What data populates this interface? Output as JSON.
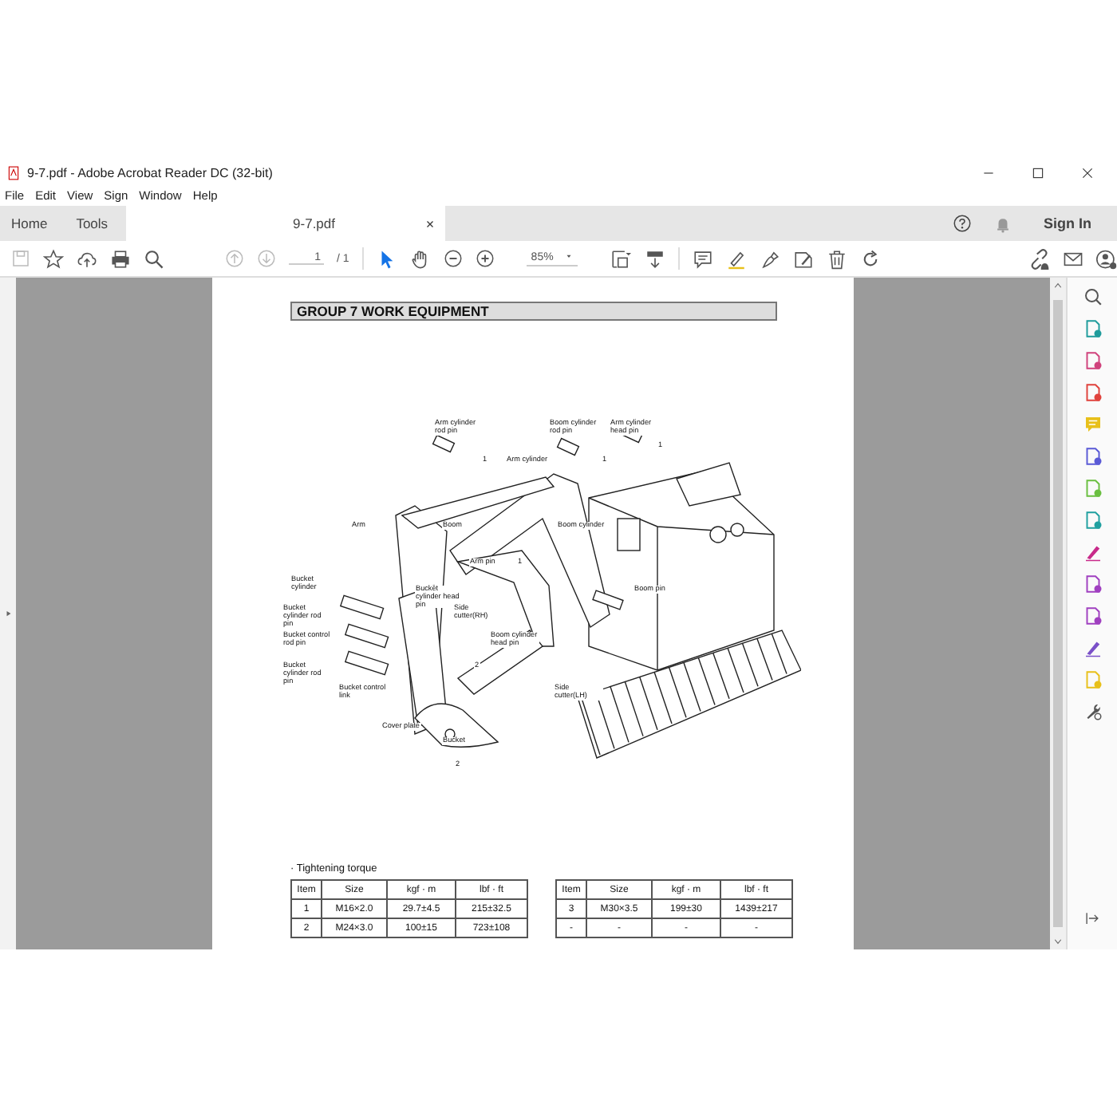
{
  "window": {
    "title": "9-7.pdf - Adobe Acrobat Reader DC (32-bit)"
  },
  "menu": [
    "File",
    "Edit",
    "View",
    "Sign",
    "Window",
    "Help"
  ],
  "tabs": [
    {
      "label": "Home",
      "selected": false
    },
    {
      "label": "Tools",
      "selected": false
    },
    {
      "label": "9-7.pdf",
      "selected": true
    }
  ],
  "sign_in": "Sign In",
  "toolbar": {
    "page": "1",
    "page_total": "/ 1",
    "zoom": "85%",
    "select_tool_selected": true
  },
  "document": {
    "heading": "GROUP  7  WORK EQUIPMENT",
    "callouts": [
      {
        "text": "Arm cylinder rod pin"
      },
      {
        "text": "Boom cylinder rod pin"
      },
      {
        "text": "Arm cylinder head pin"
      },
      {
        "text": "1"
      },
      {
        "text": "1"
      },
      {
        "text": "Arm cylinder"
      },
      {
        "text": "1"
      },
      {
        "text": "Arm"
      },
      {
        "text": "Boom"
      },
      {
        "text": "Boom cylinder"
      },
      {
        "text": "Arm pin"
      },
      {
        "text": "1"
      },
      {
        "text": "Bucket cylinder"
      },
      {
        "text": "Bucket cylinder head pin"
      },
      {
        "text": "Boom pin"
      },
      {
        "text": "Bucket cylinder rod pin"
      },
      {
        "text": "Side cutter(RH)"
      },
      {
        "text": "Bucket control rod pin"
      },
      {
        "text": "Boom cylinder head pin"
      },
      {
        "text": "Bucket cylinder rod pin"
      },
      {
        "text": "2"
      },
      {
        "text": "Bucket control link"
      },
      {
        "text": "Side cutter(LH)"
      },
      {
        "text": "Cover plate"
      },
      {
        "text": "Bucket"
      },
      {
        "text": "2"
      }
    ],
    "torque_title": "· Tightening torque",
    "tables": [
      {
        "columns": [
          "Item",
          "Size",
          "kgf · m",
          "lbf · ft"
        ],
        "rows": [
          [
            "1",
            "M16×2.0",
            "29.7±4.5",
            "215±32.5"
          ],
          [
            "2",
            "M24×3.0",
            "100±15",
            "723±108"
          ]
        ]
      },
      {
        "columns": [
          "Item",
          "Size",
          "kgf · m",
          "lbf · ft"
        ],
        "rows": [
          [
            "3",
            "M30×3.5",
            "199±30",
            "1439±217"
          ],
          [
            "-",
            "-",
            "-",
            "-"
          ]
        ]
      }
    ]
  }
}
